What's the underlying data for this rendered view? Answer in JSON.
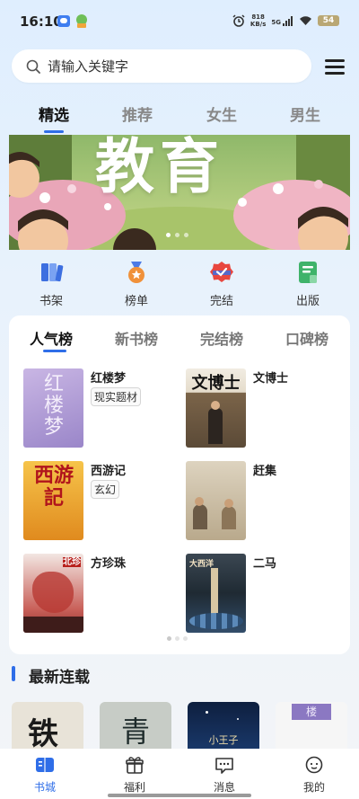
{
  "status_bar": {
    "time": "16:10",
    "net_speed_value": "818",
    "net_speed_unit": "KB/s",
    "signal_label": "5G",
    "battery": "54"
  },
  "search": {
    "placeholder": "请输入关键字"
  },
  "top_tabs": [
    {
      "label": "精选",
      "active": true
    },
    {
      "label": "推荐",
      "active": false
    },
    {
      "label": "女生",
      "active": false
    },
    {
      "label": "男生",
      "active": false
    }
  ],
  "banner": {
    "title": "教育",
    "page_count": 3,
    "active_page": 1
  },
  "quick_nav": [
    {
      "label": "书架",
      "icon": "bookshelf-icon"
    },
    {
      "label": "榜单",
      "icon": "medal-icon"
    },
    {
      "label": "完结",
      "icon": "badge-check-icon"
    },
    {
      "label": "出版",
      "icon": "publish-icon"
    }
  ],
  "rank_tabs": [
    {
      "label": "人气榜",
      "active": true
    },
    {
      "label": "新书榜",
      "active": false
    },
    {
      "label": "完结榜",
      "active": false
    },
    {
      "label": "口碑榜",
      "active": false
    }
  ],
  "rank_books": [
    {
      "title": "红楼梦",
      "tag": "现实题材",
      "cover_text": "红楼梦"
    },
    {
      "title": "文博士",
      "tag": "",
      "cover_text": "文博士"
    },
    {
      "title": "西游记",
      "tag": "玄幻",
      "cover_text": "西游記"
    },
    {
      "title": "赶集",
      "tag": "",
      "cover_text": ""
    },
    {
      "title": "方珍珠",
      "tag": "",
      "cover_text": "北珍"
    },
    {
      "title": "二马",
      "tag": "",
      "cover_text": "大西洋"
    }
  ],
  "latest": {
    "title": "最新连载",
    "covers": [
      {
        "cover_text": "铁"
      },
      {
        "cover_text": "青"
      },
      {
        "cover_text": "小王子"
      },
      {
        "cover_text": "楼"
      }
    ]
  },
  "bottom_nav": [
    {
      "label": "书城",
      "icon": "book-city-icon",
      "active": true
    },
    {
      "label": "福利",
      "icon": "gift-icon",
      "active": false
    },
    {
      "label": "消息",
      "icon": "message-icon",
      "active": false
    },
    {
      "label": "我的",
      "icon": "profile-icon",
      "active": false
    }
  ],
  "colors": {
    "accent": "#2f6ee8",
    "background": "#e8f2fc"
  }
}
